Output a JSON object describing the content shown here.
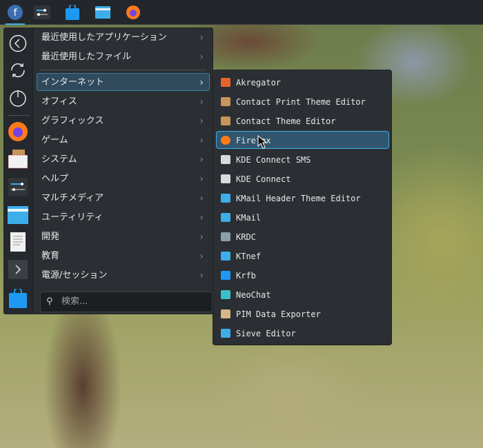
{
  "panel": {
    "items": [
      "fedora-launcher",
      "system-settings",
      "discover",
      "dolphin",
      "firefox"
    ]
  },
  "sidebar": {
    "items": [
      "back",
      "refresh",
      "power",
      "firefox",
      "kontact",
      "system-settings",
      "dolphin",
      "text-editor",
      "konsole",
      "discover"
    ]
  },
  "categories": [
    {
      "label": "最近使用したアプリケーション"
    },
    {
      "label": "最近使用したファイル"
    },
    {
      "label": "インターネット",
      "highlighted": true
    },
    {
      "label": "オフィス"
    },
    {
      "label": "グラフィックス"
    },
    {
      "label": "ゲーム"
    },
    {
      "label": "システム"
    },
    {
      "label": "ヘルプ"
    },
    {
      "label": "マルチメディア"
    },
    {
      "label": "ユーティリティ"
    },
    {
      "label": "開発"
    },
    {
      "label": "教育"
    },
    {
      "label": "電源/セッション"
    }
  ],
  "chevron": "›",
  "search": {
    "placeholder": "検索..."
  },
  "apps": [
    {
      "label": "Akregator",
      "icon": "rss-icon",
      "color": "#e8632b"
    },
    {
      "label": "Contact Print Theme Editor",
      "icon": "contact-icon",
      "color": "#c8955a"
    },
    {
      "label": "Contact Theme Editor",
      "icon": "contact-icon",
      "color": "#c8955a"
    },
    {
      "label": "Firefox",
      "icon": "firefox-icon",
      "color": "#ff7a1a",
      "highlighted": true
    },
    {
      "label": "KDE Connect SMS",
      "icon": "phone-icon",
      "color": "#d8dadc"
    },
    {
      "label": "KDE Connect",
      "icon": "phone-icon",
      "color": "#d8dadc"
    },
    {
      "label": "KMail Header Theme Editor",
      "icon": "mail-icon",
      "color": "#3daee9"
    },
    {
      "label": "KMail",
      "icon": "mail-icon",
      "color": "#3daee9"
    },
    {
      "label": "KRDC",
      "icon": "monitor-icon",
      "color": "#8aa0a8"
    },
    {
      "label": "KTnef",
      "icon": "mail-icon",
      "color": "#3daee9"
    },
    {
      "label": "Krfb",
      "icon": "monitor-icon",
      "color": "#1d99f3"
    },
    {
      "label": "NeoChat",
      "icon": "chat-icon",
      "color": "#3ac0c8"
    },
    {
      "label": "PIM Data Exporter",
      "icon": "archive-icon",
      "color": "#d8b888"
    },
    {
      "label": "Sieve Editor",
      "icon": "mail-icon",
      "color": "#3daee9"
    }
  ]
}
